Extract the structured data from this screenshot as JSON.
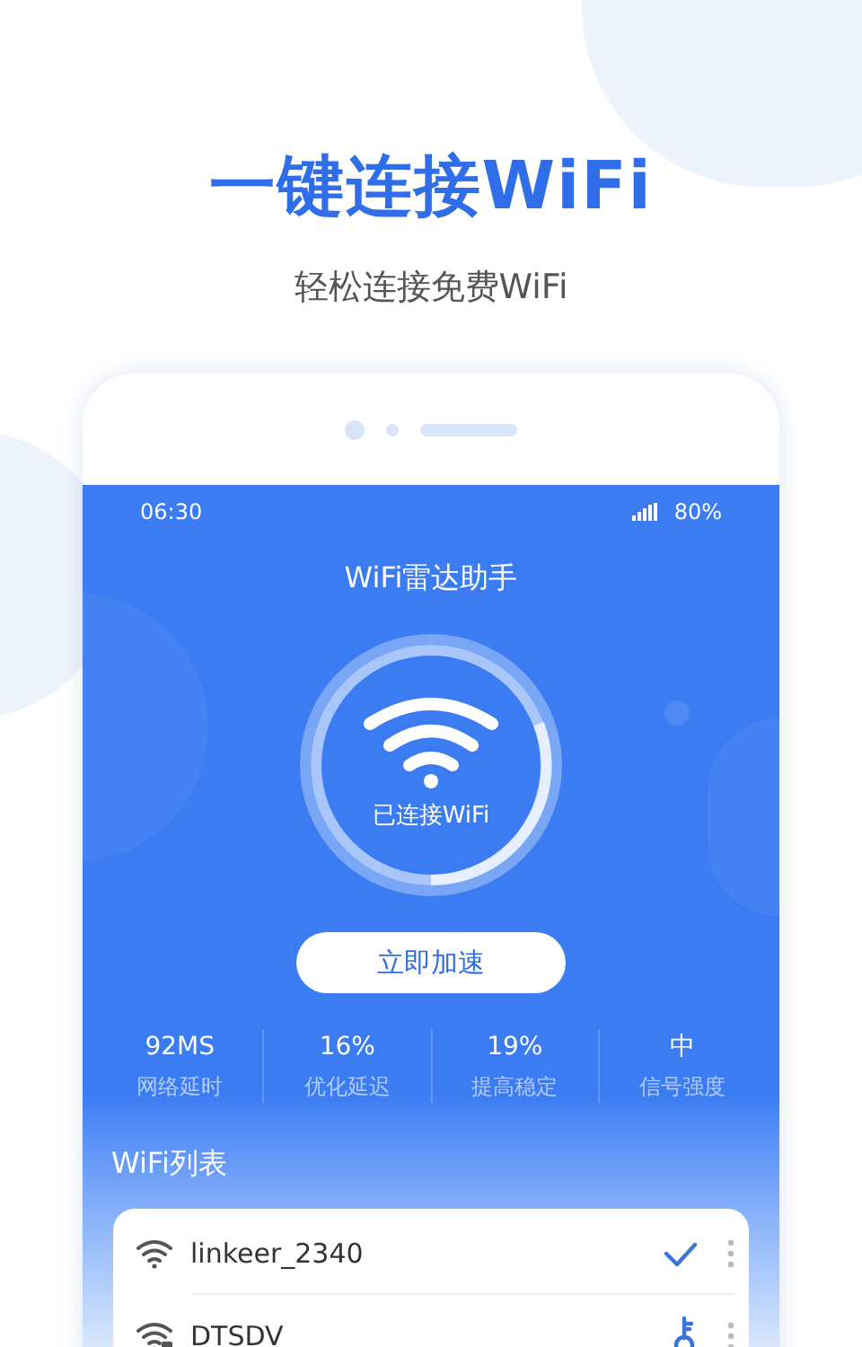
{
  "headline": "一键连接WiFi",
  "subtitle": "轻松连接免费WiFi",
  "status_bar": {
    "time": "06:30",
    "battery": "80%"
  },
  "app_title": "WiFi雷达助手",
  "ring_label": "已连接WiFi",
  "boost_button": "立即加速",
  "stats": [
    {
      "value": "92MS",
      "label": "网络延时"
    },
    {
      "value": "16%",
      "label": "优化延迟"
    },
    {
      "value": "19%",
      "label": "提高稳定"
    },
    {
      "value": "中",
      "label": "信号强度"
    }
  ],
  "list_title": "WiFi列表",
  "networks": [
    {
      "name": "linkeer_2340",
      "kind": "connected"
    },
    {
      "name": "DTSDV",
      "kind": "locked"
    }
  ]
}
